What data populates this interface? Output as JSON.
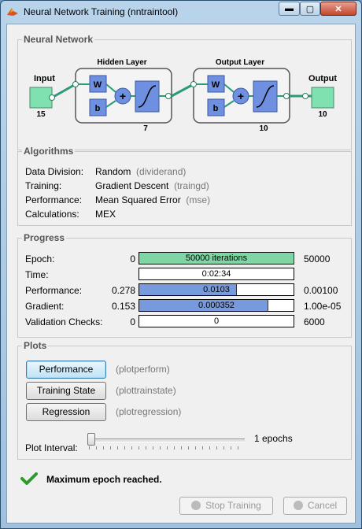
{
  "window": {
    "title": "Neural Network Training (nntraintool)",
    "min_glyph": "▬",
    "max_glyph": "▢",
    "close_glyph": "✕"
  },
  "network": {
    "panel_title": "Neural Network",
    "input_label": "Input",
    "input_size": "15",
    "hidden_layer_label": "Hidden Layer",
    "hidden_size": "7",
    "output_layer_label": "Output Layer",
    "output_layer_size": "10",
    "output_label": "Output",
    "output_size": "10",
    "w_label": "W",
    "b_label": "b",
    "sum_symbol": "+"
  },
  "algorithms": {
    "panel_title": "Algorithms",
    "rows": [
      {
        "label": "Data Division:",
        "value": "Random",
        "func": "(dividerand)"
      },
      {
        "label": "Training:",
        "value": "Gradient Descent",
        "func": "(traingd)"
      },
      {
        "label": "Performance:",
        "value": "Mean Squared Error",
        "func": "(mse)"
      },
      {
        "label": "Calculations:",
        "value": "MEX",
        "func": ""
      }
    ]
  },
  "progress": {
    "panel_title": "Progress",
    "rows": [
      {
        "label": "Epoch:",
        "start": "0",
        "bar_text": "50000 iterations",
        "end": "50000",
        "fill": 1.0,
        "color": "#7fd6a4"
      },
      {
        "label": "Time:",
        "start": "",
        "bar_text": "0:02:34",
        "end": "",
        "fill": 0,
        "color": "#7799dd"
      },
      {
        "label": "Performance:",
        "start": "0.278",
        "bar_text": "0.0103",
        "end": "0.00100",
        "fill": 0.63,
        "color": "#7799dd"
      },
      {
        "label": "Gradient:",
        "start": "0.153",
        "bar_text": "0.000352",
        "end": "1.00e-05",
        "fill": 0.83,
        "color": "#7799dd"
      },
      {
        "label": "Validation Checks:",
        "start": "0",
        "bar_text": "0",
        "end": "6000",
        "fill": 0,
        "color": "#7799dd"
      }
    ]
  },
  "plots": {
    "panel_title": "Plots",
    "buttons": [
      {
        "label": "Performance",
        "func": "(plotperform)"
      },
      {
        "label": "Training State",
        "func": "(plottrainstate)"
      },
      {
        "label": "Regression",
        "func": "(plotregression)"
      }
    ],
    "interval_label": "Plot Interval:",
    "interval_value": "1 epochs"
  },
  "status": {
    "message": "Maximum epoch reached.",
    "icon": "checkmark-icon"
  },
  "footer": {
    "stop_label": "Stop Training",
    "cancel_label": "Cancel"
  },
  "colors": {
    "node_green": "#7fe0b0",
    "node_blue": "#6f8fe0"
  }
}
